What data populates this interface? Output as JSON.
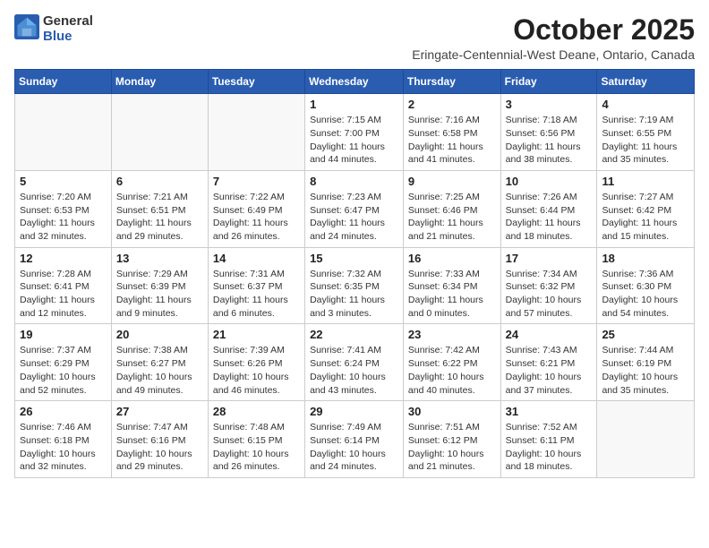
{
  "header": {
    "logo_general": "General",
    "logo_blue": "Blue",
    "title": "October 2025",
    "subtitle": "Eringate-Centennial-West Deane, Ontario, Canada"
  },
  "weekdays": [
    "Sunday",
    "Monday",
    "Tuesday",
    "Wednesday",
    "Thursday",
    "Friday",
    "Saturday"
  ],
  "weeks": [
    [
      {
        "day": "",
        "info": ""
      },
      {
        "day": "",
        "info": ""
      },
      {
        "day": "",
        "info": ""
      },
      {
        "day": "1",
        "info": "Sunrise: 7:15 AM\nSunset: 7:00 PM\nDaylight: 11 hours\nand 44 minutes."
      },
      {
        "day": "2",
        "info": "Sunrise: 7:16 AM\nSunset: 6:58 PM\nDaylight: 11 hours\nand 41 minutes."
      },
      {
        "day": "3",
        "info": "Sunrise: 7:18 AM\nSunset: 6:56 PM\nDaylight: 11 hours\nand 38 minutes."
      },
      {
        "day": "4",
        "info": "Sunrise: 7:19 AM\nSunset: 6:55 PM\nDaylight: 11 hours\nand 35 minutes."
      }
    ],
    [
      {
        "day": "5",
        "info": "Sunrise: 7:20 AM\nSunset: 6:53 PM\nDaylight: 11 hours\nand 32 minutes."
      },
      {
        "day": "6",
        "info": "Sunrise: 7:21 AM\nSunset: 6:51 PM\nDaylight: 11 hours\nand 29 minutes."
      },
      {
        "day": "7",
        "info": "Sunrise: 7:22 AM\nSunset: 6:49 PM\nDaylight: 11 hours\nand 26 minutes."
      },
      {
        "day": "8",
        "info": "Sunrise: 7:23 AM\nSunset: 6:47 PM\nDaylight: 11 hours\nand 24 minutes."
      },
      {
        "day": "9",
        "info": "Sunrise: 7:25 AM\nSunset: 6:46 PM\nDaylight: 11 hours\nand 21 minutes."
      },
      {
        "day": "10",
        "info": "Sunrise: 7:26 AM\nSunset: 6:44 PM\nDaylight: 11 hours\nand 18 minutes."
      },
      {
        "day": "11",
        "info": "Sunrise: 7:27 AM\nSunset: 6:42 PM\nDaylight: 11 hours\nand 15 minutes."
      }
    ],
    [
      {
        "day": "12",
        "info": "Sunrise: 7:28 AM\nSunset: 6:41 PM\nDaylight: 11 hours\nand 12 minutes."
      },
      {
        "day": "13",
        "info": "Sunrise: 7:29 AM\nSunset: 6:39 PM\nDaylight: 11 hours\nand 9 minutes."
      },
      {
        "day": "14",
        "info": "Sunrise: 7:31 AM\nSunset: 6:37 PM\nDaylight: 11 hours\nand 6 minutes."
      },
      {
        "day": "15",
        "info": "Sunrise: 7:32 AM\nSunset: 6:35 PM\nDaylight: 11 hours\nand 3 minutes."
      },
      {
        "day": "16",
        "info": "Sunrise: 7:33 AM\nSunset: 6:34 PM\nDaylight: 11 hours\nand 0 minutes."
      },
      {
        "day": "17",
        "info": "Sunrise: 7:34 AM\nSunset: 6:32 PM\nDaylight: 10 hours\nand 57 minutes."
      },
      {
        "day": "18",
        "info": "Sunrise: 7:36 AM\nSunset: 6:30 PM\nDaylight: 10 hours\nand 54 minutes."
      }
    ],
    [
      {
        "day": "19",
        "info": "Sunrise: 7:37 AM\nSunset: 6:29 PM\nDaylight: 10 hours\nand 52 minutes."
      },
      {
        "day": "20",
        "info": "Sunrise: 7:38 AM\nSunset: 6:27 PM\nDaylight: 10 hours\nand 49 minutes."
      },
      {
        "day": "21",
        "info": "Sunrise: 7:39 AM\nSunset: 6:26 PM\nDaylight: 10 hours\nand 46 minutes."
      },
      {
        "day": "22",
        "info": "Sunrise: 7:41 AM\nSunset: 6:24 PM\nDaylight: 10 hours\nand 43 minutes."
      },
      {
        "day": "23",
        "info": "Sunrise: 7:42 AM\nSunset: 6:22 PM\nDaylight: 10 hours\nand 40 minutes."
      },
      {
        "day": "24",
        "info": "Sunrise: 7:43 AM\nSunset: 6:21 PM\nDaylight: 10 hours\nand 37 minutes."
      },
      {
        "day": "25",
        "info": "Sunrise: 7:44 AM\nSunset: 6:19 PM\nDaylight: 10 hours\nand 35 minutes."
      }
    ],
    [
      {
        "day": "26",
        "info": "Sunrise: 7:46 AM\nSunset: 6:18 PM\nDaylight: 10 hours\nand 32 minutes."
      },
      {
        "day": "27",
        "info": "Sunrise: 7:47 AM\nSunset: 6:16 PM\nDaylight: 10 hours\nand 29 minutes."
      },
      {
        "day": "28",
        "info": "Sunrise: 7:48 AM\nSunset: 6:15 PM\nDaylight: 10 hours\nand 26 minutes."
      },
      {
        "day": "29",
        "info": "Sunrise: 7:49 AM\nSunset: 6:14 PM\nDaylight: 10 hours\nand 24 minutes."
      },
      {
        "day": "30",
        "info": "Sunrise: 7:51 AM\nSunset: 6:12 PM\nDaylight: 10 hours\nand 21 minutes."
      },
      {
        "day": "31",
        "info": "Sunrise: 7:52 AM\nSunset: 6:11 PM\nDaylight: 10 hours\nand 18 minutes."
      },
      {
        "day": "",
        "info": ""
      }
    ]
  ]
}
